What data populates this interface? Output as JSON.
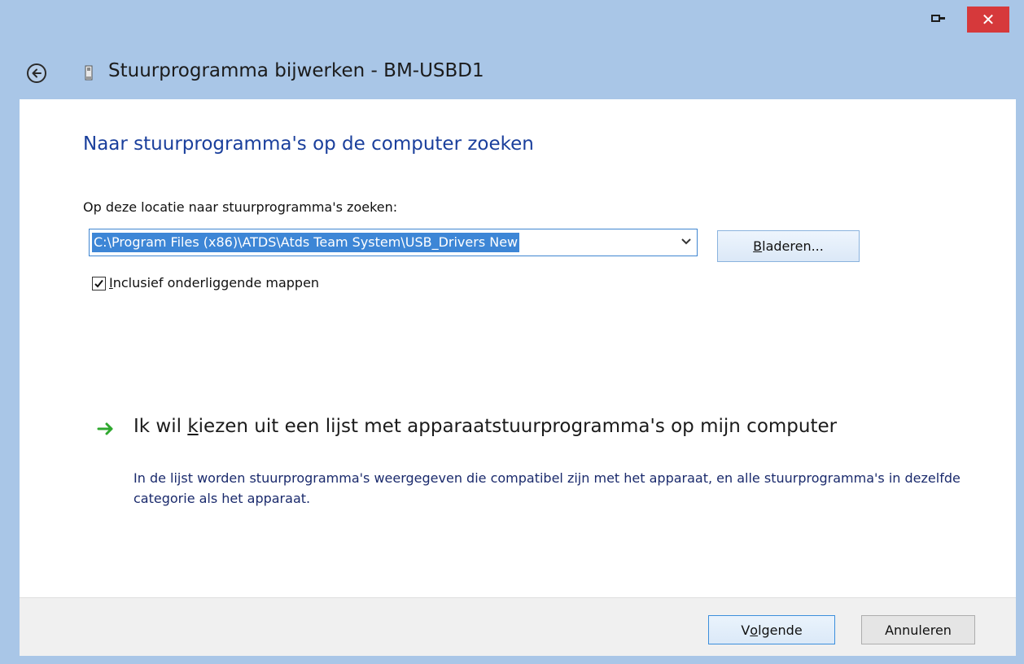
{
  "window": {
    "title": "Stuurprogramma bijwerken - BM-USBD1",
    "close_symbol": "✕"
  },
  "colors": {
    "frame": "#a9c6e7",
    "close_button": "#d6393b",
    "heading": "#1a3f9c",
    "selection": "#3d86d6",
    "link_arrow": "#2fa82f"
  },
  "icons": {
    "back": "back-arrow-icon",
    "device": "usb-device-icon",
    "restore": "restore-icon",
    "close": "close-icon",
    "dropdown": "chevron-down-icon",
    "check": "checkmark-icon",
    "link": "green-arrow-icon"
  },
  "main": {
    "heading": "Naar stuurprogramma's op de computer zoeken",
    "location_label": "Op deze locatie naar stuurprogramma's zoeken:",
    "path_value": "C:\\Program Files (x86)\\ATDS\\Atds Team System\\USB_Drivers New",
    "browse": {
      "prefix": "",
      "accel": "B",
      "rest": "laderen..."
    },
    "include_subfolders": {
      "checked": true,
      "accel": "I",
      "rest": "nclusief onderliggende mappen"
    },
    "choose_link": {
      "prefix": "Ik wil ",
      "accel": "k",
      "rest": "iezen uit een lijst met apparaatstuurprogramma's op mijn computer",
      "description": "In de lijst worden stuurprogramma's weergegeven die compatibel zijn met het apparaat, en alle stuurprogramma's in dezelfde categorie als het apparaat."
    }
  },
  "footer": {
    "next": {
      "prefix": "V",
      "accel": "o",
      "rest": "lgende"
    },
    "cancel_label": "Annuleren"
  }
}
